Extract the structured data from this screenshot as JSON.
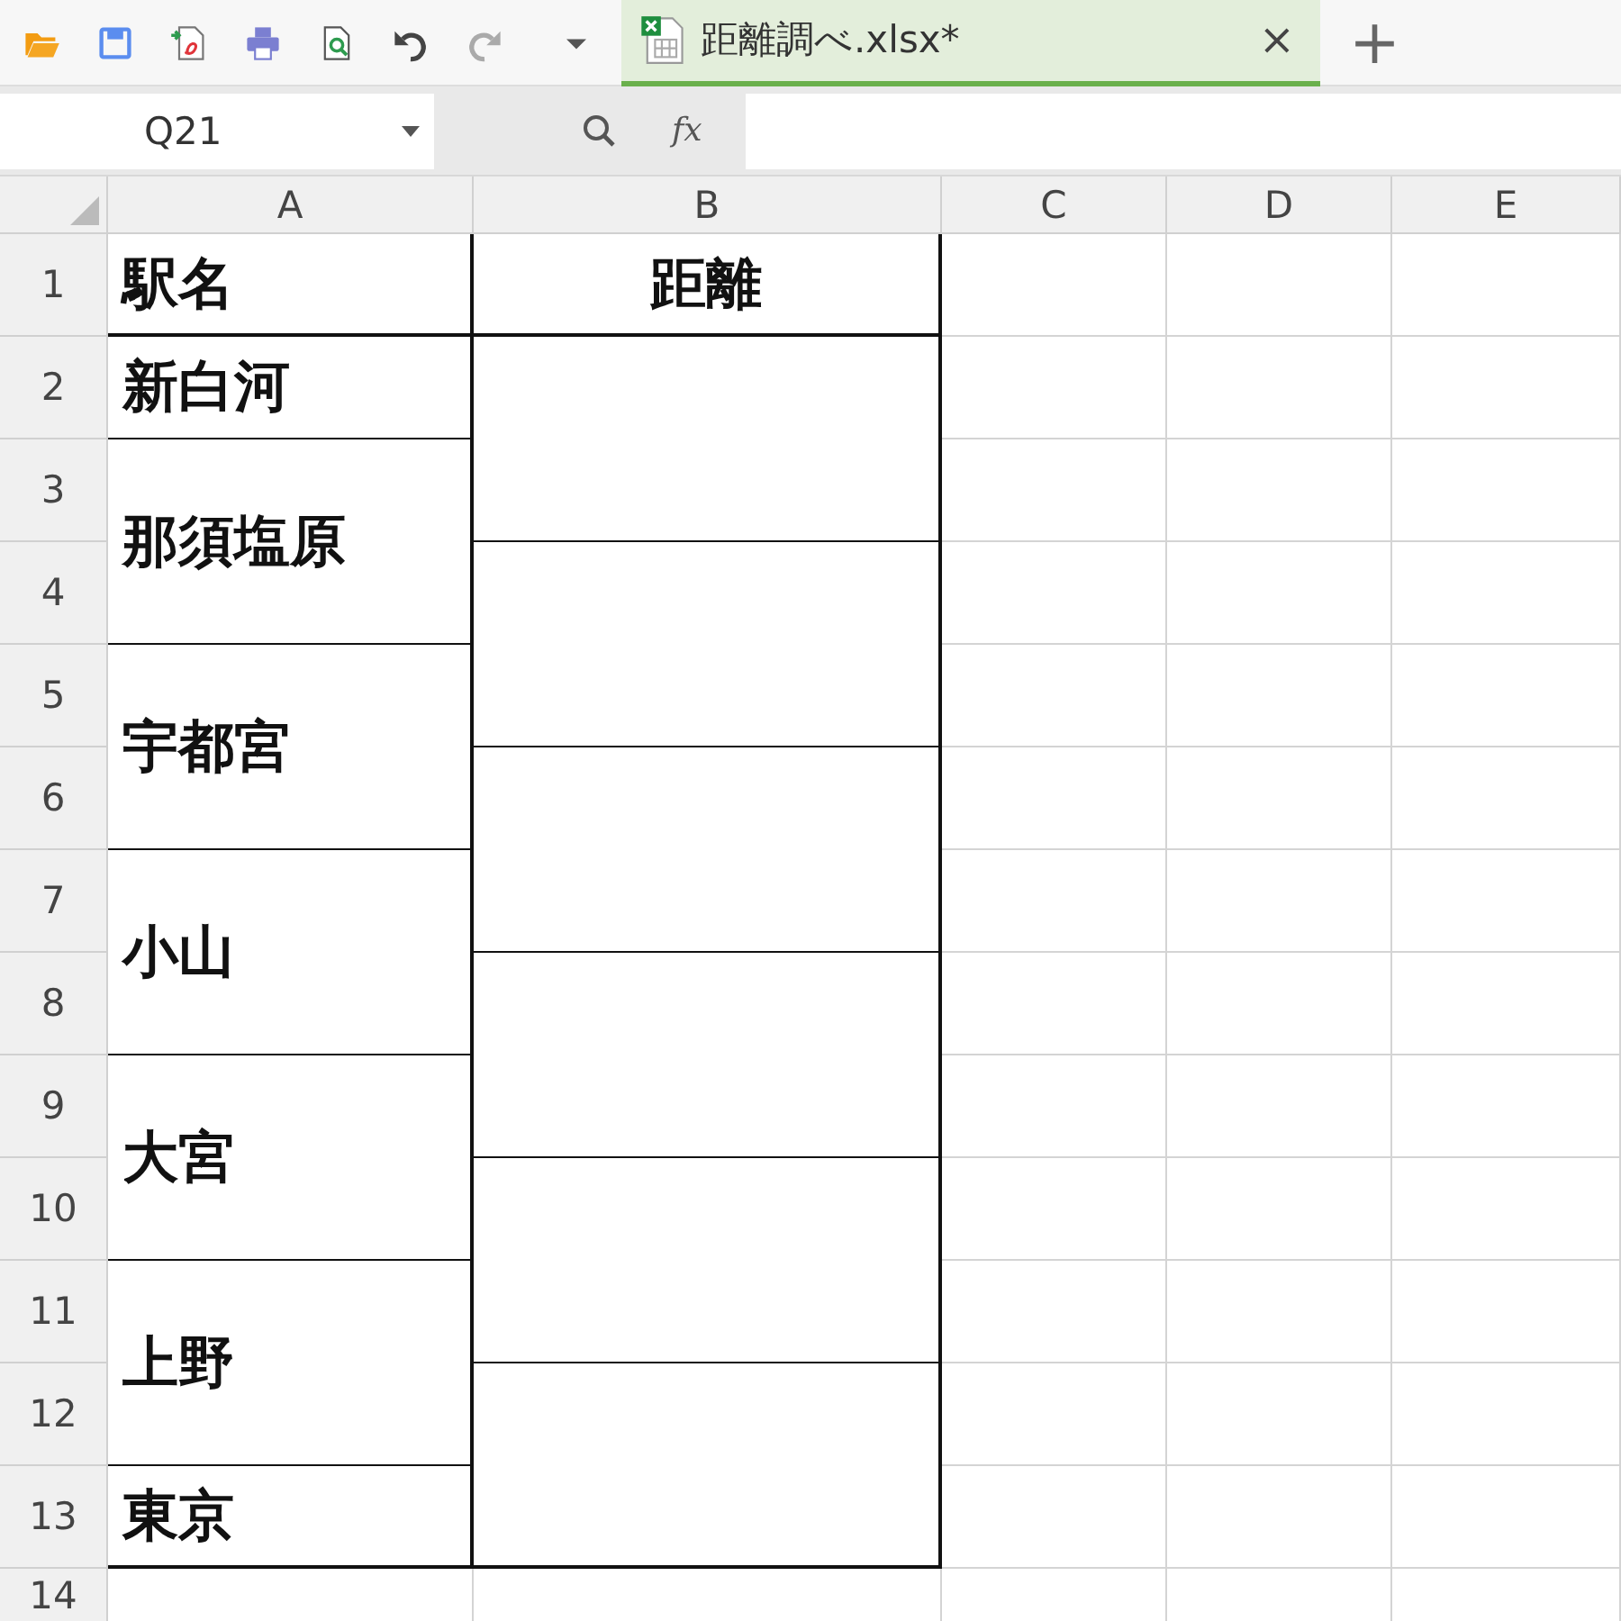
{
  "tab": {
    "title": "距離調べ.xlsx*",
    "selected": true,
    "close": "×",
    "new": "+"
  },
  "formula_bar": {
    "name_box": "Q21",
    "function_label": "fx"
  },
  "sheet": {
    "columns": [
      "A",
      "B",
      "C",
      "D",
      "E"
    ],
    "rows": [
      "1",
      "2",
      "3",
      "4",
      "5",
      "6",
      "7",
      "8",
      "9",
      "10",
      "11",
      "12",
      "13",
      "14"
    ],
    "column_a": [
      {
        "text": "駅名",
        "merged": false
      },
      {
        "text": "新白河",
        "merged": false
      },
      {
        "text": "那須塩原",
        "merged": true
      },
      {
        "text": "宇都宮",
        "merged": true
      },
      {
        "text": "小山",
        "merged": true
      },
      {
        "text": "大宮",
        "merged": true
      },
      {
        "text": "上野",
        "merged": true
      },
      {
        "text": "東京",
        "merged": false
      }
    ],
    "column_b": [
      {
        "text": "距離",
        "merged": false
      },
      {
        "merged": true
      },
      {
        "merged": true
      },
      {
        "merged": true
      },
      {
        "merged": true
      },
      {
        "merged": true
      },
      {
        "merged": true
      }
    ]
  }
}
